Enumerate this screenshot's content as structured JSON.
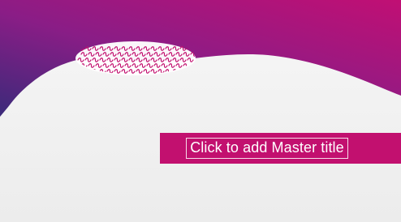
{
  "slide": {
    "title_placeholder": "Click to add Master title"
  },
  "theme": {
    "gradient_start": "#3b2a7a",
    "gradient_mid": "#8a1d86",
    "gradient_end": "#c10f74",
    "title_bar_color": "#c2106f",
    "body_top_color": "#f7f7f7",
    "body_bottom_color": "#ececec",
    "pattern_color": "#c2106f"
  },
  "icons": {
    "decorative_pattern": "squiggle-pattern-icon"
  }
}
